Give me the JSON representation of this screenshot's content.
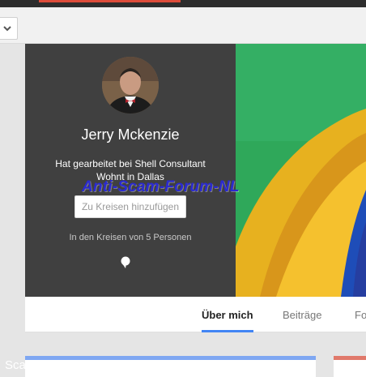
{
  "profile": {
    "name": "Jerry Mckenzie",
    "job": "Hat gearbeitet bei Shell Consultant",
    "location": "Wohnt in Dallas",
    "add_button": "Zu Kreisen hinzufügen",
    "circles_text": "In den Kreisen von 5 Personen"
  },
  "watermark": "Anti-Scam-Forum-NL",
  "tabs": [
    {
      "label": "Über mich",
      "active": true
    },
    {
      "label": "Beiträge",
      "active": false
    },
    {
      "label": "Fo",
      "active": false
    }
  ],
  "bottom_text": "Sca",
  "colors": {
    "profile_bg": "#404040",
    "accent_blue": "#4285f4",
    "top_red": "#dd4b39"
  },
  "icons": {
    "dropdown": "chevron-down-icon",
    "pin": "map-pin-icon"
  }
}
